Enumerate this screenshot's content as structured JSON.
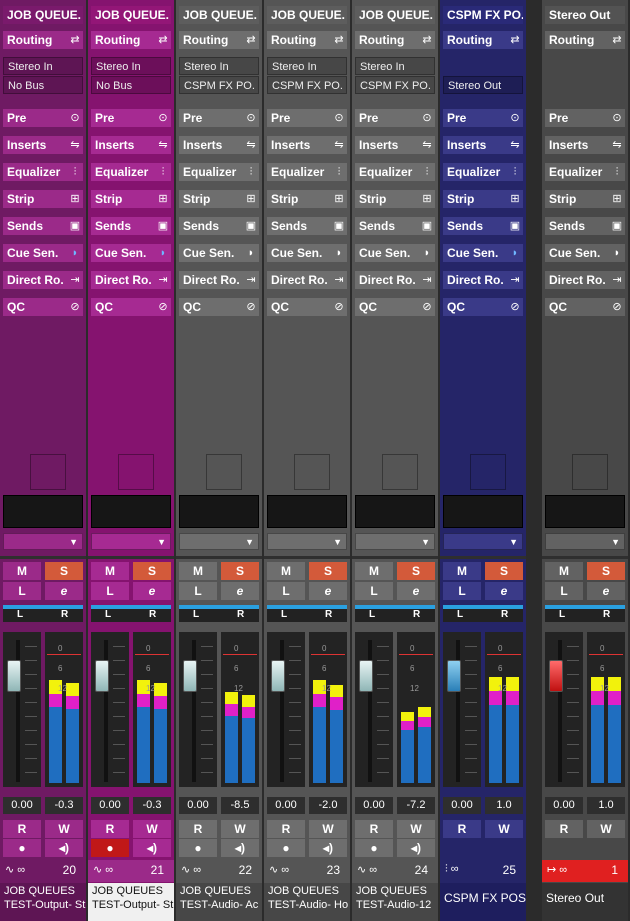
{
  "strips": [
    {
      "id": "s1",
      "title": "JOB QUEUE.",
      "io_in": "Stereo In",
      "io_out": "No Bus",
      "pan_left": "L",
      "pan_right": "R",
      "fader_value": "0.00",
      "meter_value": "-0.3",
      "number": "20",
      "name_line1": "JOB QUEUES",
      "name_line2": "TEST-Output- St",
      "rec_active": false,
      "selected": false
    },
    {
      "id": "s2",
      "title": "JOB QUEUE.",
      "io_in": "Stereo In",
      "io_out": "No Bus",
      "pan_left": "L",
      "pan_right": "R",
      "fader_value": "0.00",
      "meter_value": "-0.3",
      "number": "21",
      "name_line1": "JOB QUEUES",
      "name_line2": "TEST-Output- St",
      "rec_active": true,
      "selected": true
    },
    {
      "id": "s3",
      "title": "JOB QUEUE.",
      "io_in": "Stereo In",
      "io_out": "CSPM FX PO.",
      "pan_left": "L",
      "pan_right": "R",
      "fader_value": "0.00",
      "meter_value": "-8.5",
      "number": "22",
      "name_line1": "JOB QUEUES",
      "name_line2": "TEST-Audio- Ac",
      "rec_active": false,
      "selected": false
    },
    {
      "id": "s4",
      "title": "JOB QUEUE.",
      "io_in": "Stereo In",
      "io_out": "CSPM FX PO.",
      "pan_left": "L",
      "pan_right": "R",
      "fader_value": "0.00",
      "meter_value": "-2.0",
      "number": "23",
      "name_line1": "JOB QUEUES",
      "name_line2": "TEST-Audio- Ho",
      "rec_active": false,
      "selected": false
    },
    {
      "id": "s5",
      "title": "JOB QUEUE.",
      "io_in": "Stereo In",
      "io_out": "CSPM FX PO.",
      "pan_left": "L",
      "pan_right": "R",
      "fader_value": "0.00",
      "meter_value": "-7.2",
      "number": "24",
      "name_line1": "JOB QUEUES",
      "name_line2": "TEST-Audio-12",
      "rec_active": false,
      "selected": false
    },
    {
      "id": "s6",
      "title": "CSPM FX PO.",
      "io_in": "",
      "io_out": "Stereo Out",
      "pan_left": "L",
      "pan_right": "R",
      "fader_value": "0.00",
      "meter_value": "1.0",
      "number": "25",
      "name_line1": "CSPM FX POST",
      "name_line2": "",
      "rec_active": false,
      "selected": false
    },
    {
      "id": "s7",
      "title": "Stereo Out",
      "io_in": "",
      "io_out": "",
      "pan_left": "L",
      "pan_right": "R",
      "fader_value": "0.00",
      "meter_value": "1.0",
      "number": "1",
      "name_line1": "Stereo Out",
      "name_line2": "",
      "rec_active": false,
      "selected": false
    }
  ],
  "sections": {
    "routing": "Routing",
    "pre": "Pre",
    "inserts": "Inserts",
    "equalizer": "Equalizer",
    "strip": "Strip",
    "sends": "Sends",
    "cue_sends": "Cue Sen.",
    "direct_routing": "Direct Ro.",
    "qc": "QC"
  },
  "buttons": {
    "mute": "M",
    "solo": "S",
    "listen": "L",
    "edit": "e",
    "read": "R",
    "write": "W"
  },
  "meter_scale": [
    "0",
    "6",
    "12"
  ],
  "colors": {
    "purple": "#7a1a6c",
    "magenta": "#8c1376",
    "gray": "#5a5a5a",
    "navy": "#25256b",
    "master": "#4c4c4c",
    "solo": "#d35a3a",
    "pan_blue": "#2aa0e0",
    "meter_blue": "#1f6ec0",
    "meter_magenta": "#e020c8",
    "meter_yellow": "#f2f20c",
    "record_red": "#e02020"
  }
}
